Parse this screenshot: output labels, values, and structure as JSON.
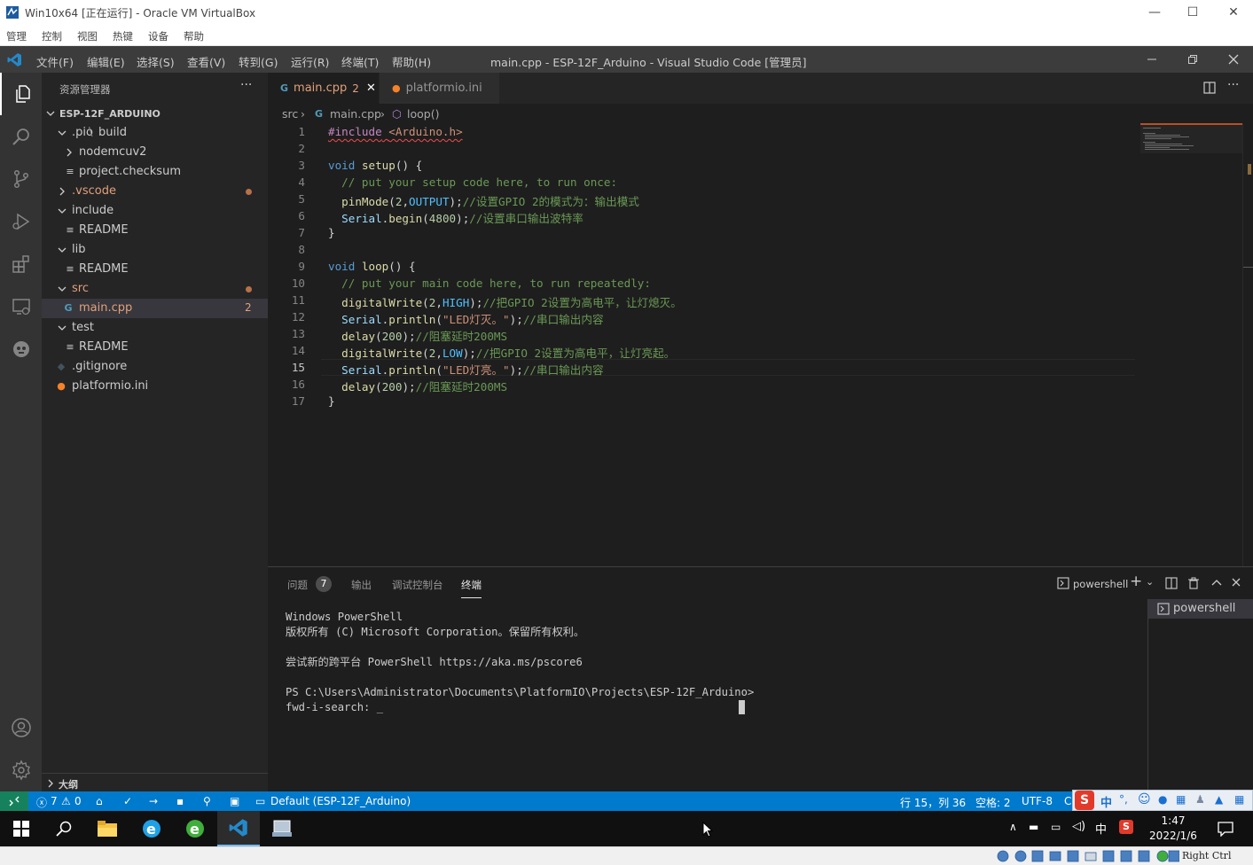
{
  "vbox": {
    "title": "Win10x64 [正在运行] - Oracle VM VirtualBox",
    "menu": [
      "管理",
      "控制",
      "视图",
      "热键",
      "设备",
      "帮助"
    ],
    "host_key": "Right Ctrl"
  },
  "vscode": {
    "menu": [
      "文件(F)",
      "编辑(E)",
      "选择(S)",
      "查看(V)",
      "转到(G)",
      "运行(R)",
      "终端(T)",
      "帮助(H)"
    ],
    "window_title": "main.cpp - ESP-12F_Arduino - Visual Studio Code [管理员]"
  },
  "explorer": {
    "header": "资源管理器",
    "more": "···",
    "project": "ESP-12F_ARDUINO",
    "items": [
      {
        "label": ".pio",
        "sub": "build",
        "type": "folder-open"
      },
      {
        "label": "nodemcuv2",
        "type": "folder-closed"
      },
      {
        "label": "project.checksum",
        "type": "file"
      },
      {
        "label": ".vscode",
        "type": "folder-closed",
        "modified": true
      },
      {
        "label": "include",
        "type": "folder-open"
      },
      {
        "label": "README",
        "type": "file"
      },
      {
        "label": "lib",
        "type": "folder-open"
      },
      {
        "label": "README",
        "type": "file"
      },
      {
        "label": "src",
        "type": "folder-open",
        "modified": true
      },
      {
        "label": "main.cpp",
        "type": "cpp",
        "badge": "2"
      },
      {
        "label": "test",
        "type": "folder-open"
      },
      {
        "label": "README",
        "type": "file"
      },
      {
        "label": ".gitignore",
        "type": "git"
      },
      {
        "label": "platformio.ini",
        "type": "pio"
      }
    ],
    "outline": "大纲"
  },
  "tabs": [
    {
      "label": "main.cpp",
      "badge": "2",
      "active": true
    },
    {
      "label": "platformio.ini",
      "active": false
    }
  ],
  "breadcrumb": {
    "folder": "src",
    "file": "main.cpp",
    "symbol": "loop()"
  },
  "editor": {
    "line_numbers": [
      "1",
      "2",
      "3",
      "4",
      "5",
      "6",
      "7",
      "8",
      "9",
      "10",
      "11",
      "12",
      "13",
      "14",
      "15",
      "16",
      "17"
    ],
    "current_line": "15"
  },
  "panel": {
    "tabs": [
      "问题",
      "输出",
      "调试控制台",
      "终端"
    ],
    "problems_count": "7",
    "active_tab": "终端",
    "shell": "powershell",
    "terminal_lines": [
      "Windows PowerShell",
      "版权所有 (C) Microsoft Corporation。保留所有权利。",
      "",
      "尝试新的跨平台 PowerShell https://aka.ms/pscore6",
      "",
      "PS C:\\Users\\Administrator\\Documents\\PlatformIO\\Projects\\ESP-12F_Arduino>",
      "fwd-i-search: _"
    ],
    "terminal_list": [
      "powershell"
    ]
  },
  "status": {
    "errors": "7",
    "warnings": "0",
    "env": "Default (ESP-12F_Arduino)",
    "position": "行 15，列 36",
    "spaces": "空格: 2",
    "encoding": "UTF-8",
    "eol": "C",
    "ime": "中"
  },
  "taskbar": {
    "ime": "中",
    "time": "1:47",
    "date": "2022/1/6"
  },
  "colors": {
    "status_bar": "#007acc",
    "remote": "#16825d",
    "modified": "#e2a07a"
  }
}
